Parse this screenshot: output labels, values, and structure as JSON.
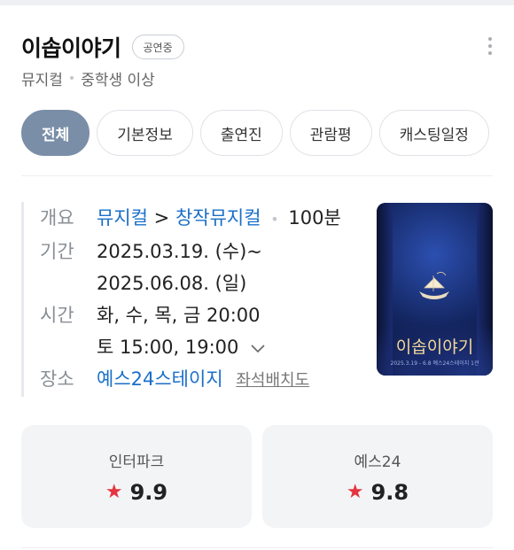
{
  "header": {
    "title": "이솝이야기",
    "status_badge": "공연중",
    "genre": "뮤지컬",
    "age": "중학생 이상"
  },
  "tabs": [
    {
      "label": "전체",
      "active": true
    },
    {
      "label": "기본정보",
      "active": false
    },
    {
      "label": "출연진",
      "active": false
    },
    {
      "label": "관람평",
      "active": false
    },
    {
      "label": "캐스팅일정",
      "active": false
    }
  ],
  "info": {
    "overview_label": "개요",
    "category": "뮤지컬",
    "arrow": ">",
    "subcategory": "창작뮤지컬",
    "duration": "100분",
    "period_label": "기간",
    "period_start": "2025.03.19. (수)~",
    "period_end": "2025.06.08. (일)",
    "time_label": "시간",
    "time_weekday": "화, 수, 목, 금 20:00",
    "time_weekend": "토 15:00, 19:00",
    "venue_label": "장소",
    "venue": "예스24스테이지",
    "seat_map": "좌석배치도"
  },
  "poster": {
    "title": "이솝이야기",
    "caption": "2025.3.19 - 6.8 예스24스테이지 1관"
  },
  "ratings": [
    {
      "source": "인터파크",
      "score": "9.9"
    },
    {
      "source": "예스24",
      "score": "9.8"
    }
  ],
  "colors": {
    "active_tab": "#7a8ea8",
    "link": "#1a6fc9",
    "star": "#e5333f",
    "card_bg": "#f3f4f6"
  },
  "icons": {
    "more": "more-vertical-icon",
    "expand": "chevron-down-icon",
    "star": "star-icon"
  }
}
